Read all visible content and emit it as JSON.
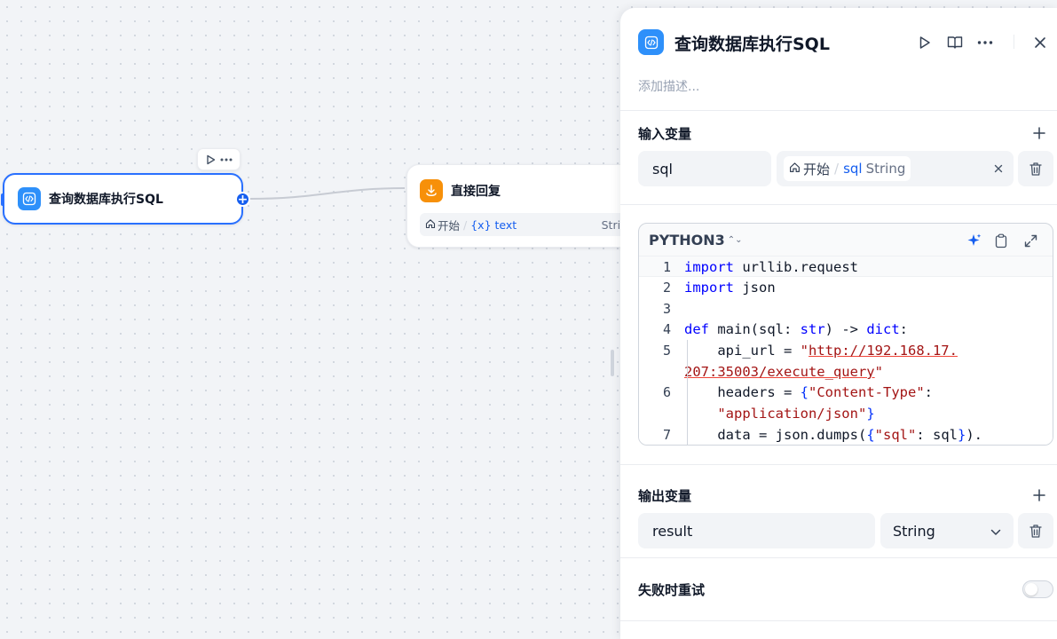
{
  "canvas": {
    "code_node": {
      "title": "查询数据库执行SQL",
      "icon": "code-icon"
    },
    "answer_node": {
      "title": "直接回复",
      "icon": "answer-icon",
      "var_source": "开始",
      "var_name": "{x} text",
      "var_type": "Strin"
    }
  },
  "panel": {
    "title": "查询数据库执行SQL",
    "description_placeholder": "添加描述...",
    "input_section": {
      "title": "输入变量",
      "variable_name": "sql",
      "ref_source": "开始",
      "ref_separator": "/",
      "ref_var": "sql",
      "ref_type": "String"
    },
    "code": {
      "language": "PYTHON3",
      "lines": [
        {
          "num": "1"
        },
        {
          "num": "2"
        },
        {
          "num": "3"
        },
        {
          "num": "4"
        },
        {
          "num": "5"
        },
        {
          "num": "6"
        },
        {
          "num": "7"
        }
      ]
    },
    "output_section": {
      "title": "输出变量",
      "variable_name": "result",
      "type": "String"
    },
    "retry": {
      "label": "失败时重试",
      "enabled": false
    }
  },
  "colors": {
    "accent": "#155eef",
    "code_icon_bg": "#2e90fa",
    "answer_icon_bg": "#f79009"
  }
}
